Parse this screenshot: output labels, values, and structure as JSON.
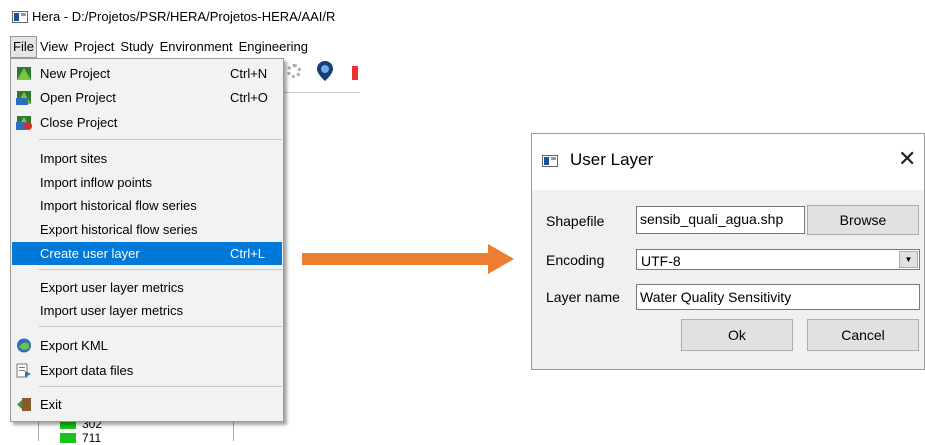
{
  "window": {
    "title": "Hera - D:/Projetos/PSR/HERA/Projetos-HERA/AAI/R"
  },
  "menubar": [
    "File",
    "View",
    "Project",
    "Study",
    "Environment",
    "Engineering"
  ],
  "file_menu": {
    "new_project": {
      "label": "New Project",
      "shortcut": "Ctrl+N",
      "icon": "new-project-icon"
    },
    "open_project": {
      "label": "Open Project",
      "shortcut": "Ctrl+O",
      "icon": "open-project-icon"
    },
    "close_project": {
      "label": "Close Project",
      "icon": "close-project-icon"
    },
    "import_sites": {
      "label": "Import sites"
    },
    "import_inflow": {
      "label": "Import inflow points"
    },
    "import_hist": {
      "label": "Import historical flow series"
    },
    "export_hist": {
      "label": "Export historical flow series"
    },
    "create_layer": {
      "label": "Create user layer",
      "shortcut": "Ctrl+L"
    },
    "export_metrics": {
      "label": "Export user layer metrics"
    },
    "import_metrics": {
      "label": "Import user layer metrics"
    },
    "export_kml": {
      "label": "Export KML",
      "icon": "kml-icon"
    },
    "export_data": {
      "label": "Export data files",
      "icon": "export-data-icon"
    },
    "exit": {
      "label": "Exit",
      "icon": "exit-icon"
    }
  },
  "tree": [
    "302",
    "711"
  ],
  "colors": {
    "highlight": "#0078d7",
    "arrow": "#ed7d31",
    "tree_marker": "#19c319"
  },
  "dialog": {
    "title": "User Layer",
    "close": "✕",
    "shapefile_label": "Shapefile",
    "shapefile_value": "sensib_quali_agua.shp",
    "browse": "Browse",
    "encoding_label": "Encoding",
    "encoding_value": "UTF-8",
    "layer_name_label": "Layer name",
    "layer_name_value": "Water Quality Sensitivity",
    "ok": "Ok",
    "cancel": "Cancel"
  }
}
